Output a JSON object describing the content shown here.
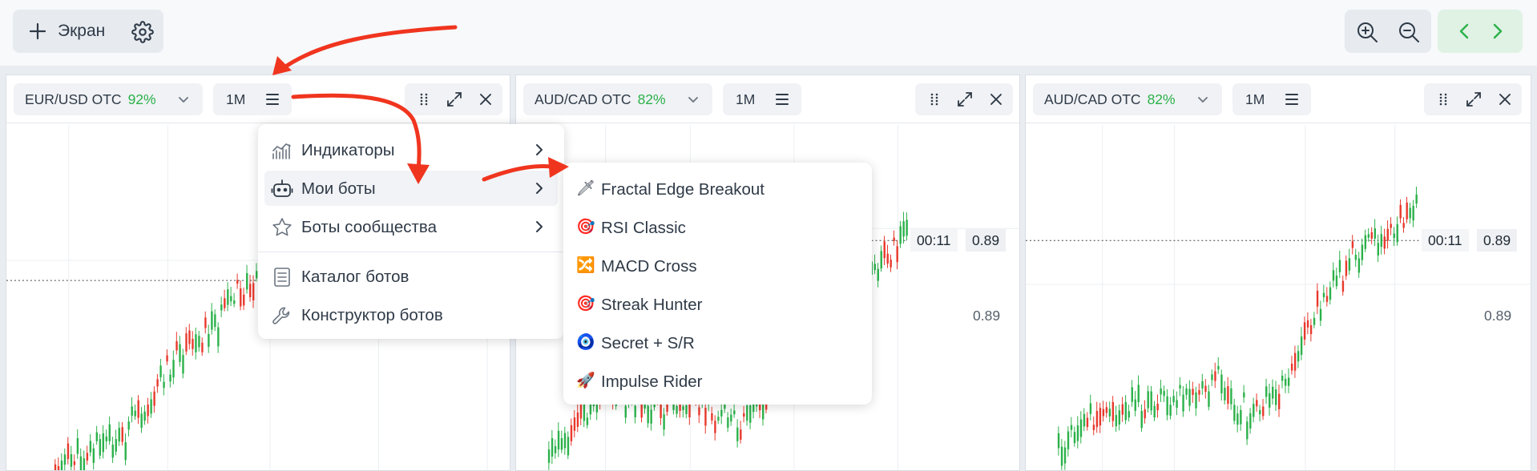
{
  "topbar": {
    "add_screen_label": "Экран",
    "plus_icon": "plus-icon",
    "settings_icon": "gear-icon",
    "zoom_in_icon": "zoom-in-icon",
    "zoom_out_icon": "zoom-out-icon",
    "prev_icon": "chevron-left-icon",
    "next_icon": "chevron-right-icon"
  },
  "panels": [
    {
      "pair": "EUR/USD OTC",
      "payout": "92%",
      "timeframe": "1M",
      "current_price": "",
      "timer": "",
      "price_level": ""
    },
    {
      "pair": "AUD/CAD OTC",
      "payout": "82%",
      "timeframe": "1M",
      "current_price": "0.89",
      "timer": "00:11",
      "price_level": "0.89"
    },
    {
      "pair": "AUD/CAD OTC",
      "payout": "82%",
      "timeframe": "1M",
      "current_price": "0.89",
      "timer": "00:11",
      "price_level": "0.89"
    }
  ],
  "menu": {
    "items": [
      {
        "label": "Индикаторы",
        "icon": "indicators-chart-icon",
        "has_submenu": true,
        "active": false
      },
      {
        "label": "Мои боты",
        "icon": "robot-icon",
        "has_submenu": true,
        "active": true
      },
      {
        "label": "Боты сообщества",
        "icon": "star-icon",
        "has_submenu": true,
        "active": false
      },
      {
        "label": "Каталог ботов",
        "icon": "catalog-icon",
        "has_submenu": false,
        "active": false
      },
      {
        "label": "Конструктор ботов",
        "icon": "wrench-icon",
        "has_submenu": false,
        "active": false
      }
    ]
  },
  "submenu": {
    "items": [
      {
        "label": "Fractal Edge Breakout",
        "emoji": "🗡"
      },
      {
        "label": "RSI Classic",
        "emoji": "🎯"
      },
      {
        "label": "MACD Cross",
        "emoji": "🔀"
      },
      {
        "label": "Streak Hunter",
        "emoji": "🎯"
      },
      {
        "label": "Secret + S/R",
        "emoji": "🧿"
      },
      {
        "label": "Impulse Rider",
        "emoji": "🚀"
      }
    ]
  },
  "colors": {
    "up_candle": "#2bb14a",
    "down_candle": "#e8392c",
    "payout_green": "#2bb14a",
    "annotation_arrow": "#f0351f"
  }
}
